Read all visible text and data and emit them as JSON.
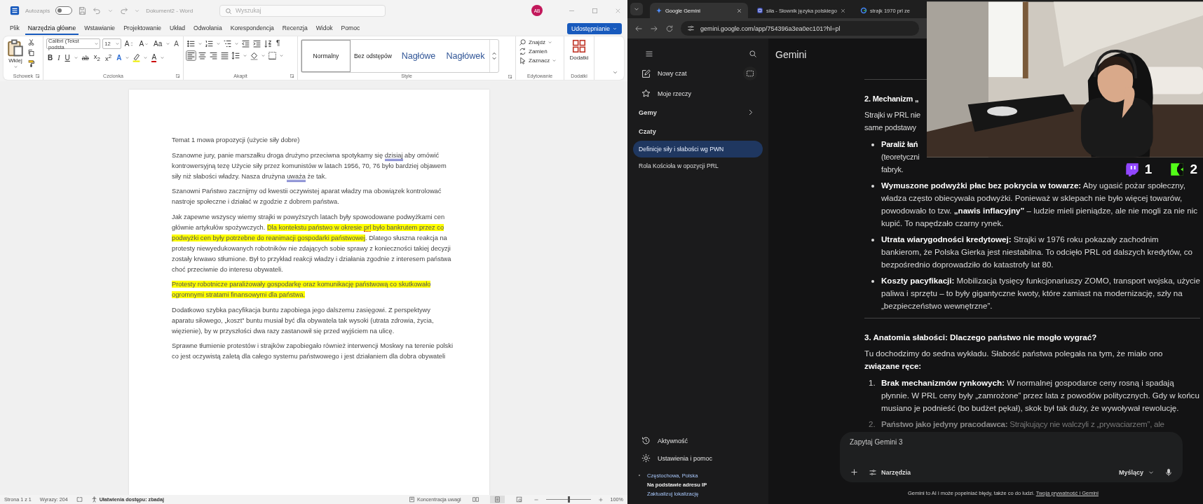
{
  "word": {
    "title_bar": {
      "autosave_label": "Autozapis",
      "autosave_on": false,
      "document_title": "Dokument2 - Word",
      "search_placeholder": "Wyszukaj",
      "avatar_initials": "AB"
    },
    "ribbon_tabs": [
      {
        "label": "Plik",
        "selected": false
      },
      {
        "label": "Narzędzia główne",
        "selected": true
      },
      {
        "label": "Wstawianie",
        "selected": false
      },
      {
        "label": "Projektowanie",
        "selected": false
      },
      {
        "label": "Układ",
        "selected": false
      },
      {
        "label": "Odwołania",
        "selected": false
      },
      {
        "label": "Korespondencja",
        "selected": false
      },
      {
        "label": "Recenzja",
        "selected": false
      },
      {
        "label": "Widok",
        "selected": false
      },
      {
        "label": "Pomoc",
        "selected": false
      }
    ],
    "share_button": "Udostępnianie",
    "ribbon": {
      "paste_label": "Wklej",
      "font_name": "Calibri (Tekst podsta",
      "font_size": "12",
      "font_row1": [
        {
          "kind": "grow",
          "label": "A"
        },
        {
          "kind": "shrink",
          "label": "A"
        },
        {
          "kind": "case",
          "label": "Aa"
        },
        {
          "kind": "clear",
          "label": "A"
        }
      ],
      "font_row2": [
        {
          "kind": "bold",
          "label": "B"
        },
        {
          "kind": "italic",
          "label": "I"
        },
        {
          "kind": "underline",
          "label": "U"
        },
        {
          "kind": "strike",
          "label": "ab"
        },
        {
          "kind": "sub",
          "label": "x$_{2}$"
        },
        {
          "kind": "sup",
          "label": "x$^{2}$"
        },
        {
          "kind": "effects",
          "label": "A"
        },
        {
          "kind": "highlight"
        },
        {
          "kind": "color",
          "label": "A"
        }
      ],
      "pilcrow": "¶",
      "styles": [
        {
          "label": "Normalny",
          "kind": "body",
          "selected": true
        },
        {
          "label": "Bez odstępów",
          "kind": "body",
          "selected": false
        },
        {
          "label": "Nagłówe",
          "kind": "heading",
          "selected": false
        },
        {
          "label": "Nagłówek",
          "kind": "heading",
          "selected": false
        }
      ],
      "edit_actions": [
        {
          "label": "Znajdź",
          "kind": "find"
        },
        {
          "label": "Zamień",
          "kind": "replace"
        },
        {
          "label": "Zaznacz",
          "kind": "select"
        }
      ],
      "addins_label": "Dodatki",
      "groups": [
        "Schowek",
        "Czcionka",
        "Akapit",
        "Style",
        "Edytowanie",
        "Dodatki"
      ]
    },
    "document": {
      "paragraphs": [
        {
          "segments": [
            {
              "text": "Temat 1 mowa propozycji (użycie siły dobre)"
            }
          ]
        },
        {
          "segments": [
            {
              "text": "Szanowne jury, panie marszałku droga drużyno przeciwna spotykamy się "
            },
            {
              "text": "dzisiaj",
              "grammar_underline": true
            },
            {
              "text": " aby omówić kontrowersyjną tezę Użycie siły przez komunistów w latach 1956, 70, 76 było bardziej objawem siły niż słabości władzy. Nasza drużyna "
            },
            {
              "text": "uważa",
              "grammar_underline": true
            },
            {
              "text": " że tak."
            }
          ]
        },
        {
          "segments": [
            {
              "text": "Szanowni Państwo zacznijmy od kwestii oczywistej aparat władzy ma obowiązek kontrolować nastroje społeczne i działać w zgodzie z dobrem państwa."
            }
          ]
        },
        {
          "segments": [
            {
              "text": "Jak zapewne wszyscy wiemy strajki w powyższych latach były spowodowane podwyżkami cen głównie artykułów spożywczych. "
            },
            {
              "text": "Dla kontekstu państwo w okresie ",
              "highlight": true
            },
            {
              "text": "prl",
              "highlight": true,
              "spelling_underline": true
            },
            {
              "text": " było bankrutem przez co podwyżki cen były potrzebne do reanimacji gospodarki państwowej",
              "highlight": true
            },
            {
              "text": ". Dlatego słuszna reakcja na protesty niewyedukowanych robotników nie zdających sobie sprawy z konieczności takiej decyzji zostały krwawo stłumione. Był to przykład reakcji władzy i działania zgodnie z interesem państwa choć przeciwnie do interesu obywateli."
            }
          ]
        },
        {
          "segments": [
            {
              "text": "Protesty robotnicze paraliżowały gospodarkę oraz komunikację państwową co skutkowało ogromnymi stratami finansowymi dla państwa.",
              "highlight": true
            }
          ]
        },
        {
          "segments": [
            {
              "text": "Dodatkowo szybka pacyfikacja buntu zapobiega jego dalszemu zasięgowi. Z perspektywy aparatu siłowego, „koszt” buntu musiał być dla obywatela tak wysoki (utrata zdrowia, życia, więzienie), by w przyszłości dwa razy zastanowił się przed wyjściem na ulicę."
            }
          ]
        },
        {
          "segments": [
            {
              "text": "Sprawne tłumienie protestów i strajków zapobiegało również interwencji Moskwy na terenie polski co jest oczywistą zaletą dla całego systemu państwowego i jest działaniem dla dobra obywateli"
            }
          ]
        }
      ]
    },
    "status_bar": {
      "page": "Strona 1 z 1",
      "words": "Wyrazy: 204",
      "accessibility": "Ułatwienia dostępu: zbadaj",
      "focus": "Koncentracja uwagi",
      "views": [
        {
          "selected": false
        },
        {
          "selected": true
        },
        {
          "selected": false
        }
      ],
      "zoom": {
        "level": 0.5,
        "reading": "100%"
      }
    }
  },
  "browser": {
    "tabs": [
      {
        "title": "Google Gemini",
        "kind": "sparkle",
        "selected": true
      },
      {
        "title": "siła - Słownik języka polskiego",
        "kind": "book",
        "selected": false
      },
      {
        "title": "strajk 1970 prl ze",
        "kind": "ring",
        "selected": false
      }
    ],
    "url": "gemini.google.com/app/754396a3ea0ec101?hl=pl",
    "gemini": {
      "sidebar": {
        "actions": [
          {
            "label": "Nowy czat",
            "kind": "new-chat"
          },
          {
            "label": "Moje rzeczy",
            "kind": "my-stuff"
          }
        ],
        "gems_label": "Gemy",
        "chats_label": "Czaty",
        "chats": [
          {
            "title": "Definicje siły i słabości wg PWN",
            "selected": true
          },
          {
            "title": "Rola Kościoła w opozycji PRL",
            "selected": false
          }
        ],
        "bottom": [
          {
            "label": "Aktywność",
            "kind": "activity"
          },
          {
            "label": "Ustawienia i pomoc",
            "kind": "settings"
          }
        ],
        "location": {
          "place": "Częstochowa, Polska",
          "source": "Na podstawie adresu IP",
          "update_link": "Zaktualizuj lokalizację"
        }
      },
      "header_title": "Gemini",
      "response": [
        {
          "kind": "divider"
        },
        {
          "kind": "heading",
          "lines": [
            "2. Mechanizm „"
          ]
        },
        {
          "kind": "paragraph",
          "lines": [
            "Strajki w PRL nie",
            "same podstawy"
          ]
        },
        {
          "kind": "bullet",
          "lines": [
            "**Paraliż łań**",
            "(teoretyczni",
            "fabryk."
          ]
        },
        {
          "kind": "bullet",
          "text": "**Wymuszone podwyżki płac bez pokrycia w towarze:** Aby ugasić pożar społeczny, władza często obiecywała podwyżki. Ponieważ w sklepach nie było więcej towarów, powodowało to tzw. **„nawis inflacyjny”** – ludzie mieli pieniądze, ale nie mogli za nie nic kupić. To napędzało czarny rynek."
        },
        {
          "kind": "bullet",
          "text": "**Utrata wiarygodności kredytowej:** Strajki w 1976 roku pokazały zachodnim bankierom, że Polska Gierka jest niestabilna. To odcięło PRL od dalszych kredytów, co bezpośrednio doprowadziło do katastrofy lat 80."
        },
        {
          "kind": "bullet",
          "text": "**Koszty pacyfikacji:** Mobilizacja tysięcy funkcjonariuszy ZOMO, transport wojska, użycie paliwa i sprzętu – to były gigantyczne kwoty, które zamiast na modernizację, szły na „bezpieczeństwo wewnętrzne”."
        },
        {
          "kind": "divider"
        },
        {
          "kind": "heading",
          "text": "3. Anatomia słabości: Dlaczego państwo nie mogło wygrać?"
        },
        {
          "kind": "paragraph",
          "text": "Tu dochodzimy do sedna wykładu. Słabość państwa polegała na tym, że miało ono **związane ręce:**"
        },
        {
          "kind": "numbered",
          "number": "1.",
          "text": "**Brak mechanizmów rynkowych:** W normalnej gospodarce ceny rosną i spadają płynnie. W PRL ceny były „zamrożone” przez lata z powodów politycznych. Gdy w końcu musiano je podnieść (bo budżet pękał), skok był tak duży, że wywoływał rewolucję."
        },
        {
          "kind": "numbered",
          "number": "2.",
          "text": "**Państwo jako jedyny pracodawca:** Strajkujący nie walczyli z „prywaciarzem”, ale"
        }
      ],
      "prompt": {
        "placeholder": "Zapytaj Gemini 3",
        "tools_label": "Narzędzia",
        "mode": "Myślący"
      },
      "disclaimer": "Gemini to AI i może popełniać błędy, także co do ludzi.",
      "privacy_link": "Twoja prywatność i Gemini"
    },
    "stream_overlay": {
      "badges": [
        {
          "kind": "twitch",
          "count": "1"
        },
        {
          "kind": "kick",
          "count": "2"
        }
      ]
    }
  }
}
